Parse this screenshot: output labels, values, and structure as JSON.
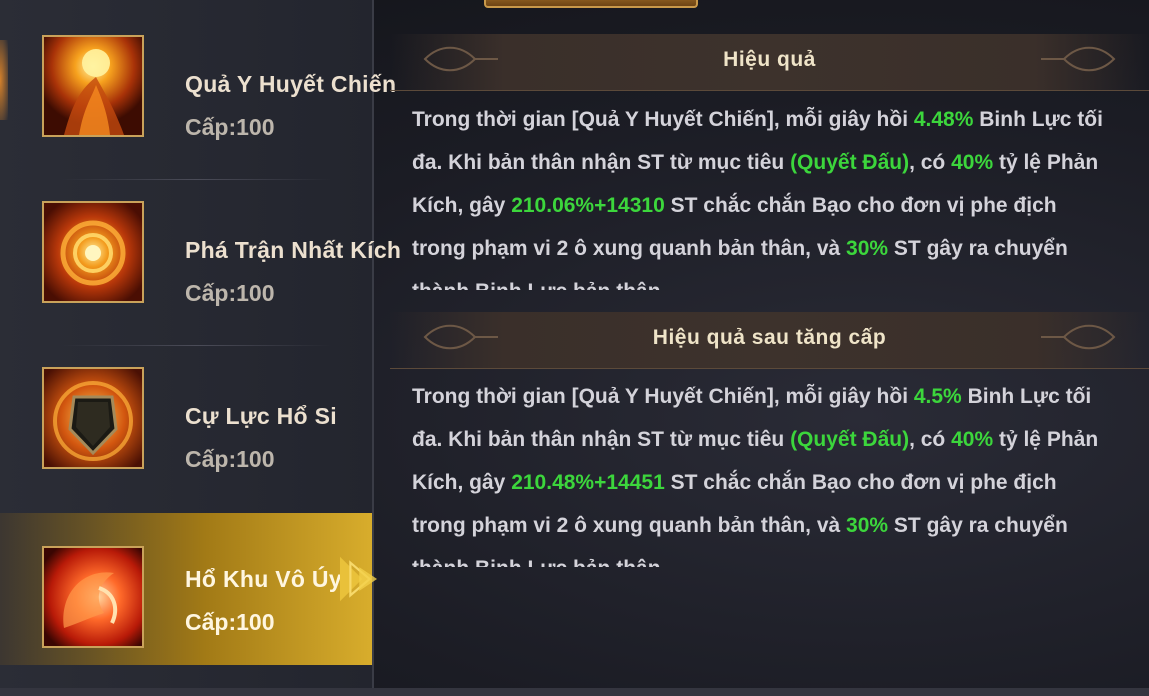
{
  "skills": [
    {
      "name": "Quả Y Huyết Chiến",
      "level": "Cấp:100",
      "icon": "flame-fist-icon",
      "selected": false
    },
    {
      "name": "Phá Trận Nhất Kích",
      "level": "Cấp:100",
      "icon": "fire-vortex-icon",
      "selected": false
    },
    {
      "name": "Cự Lực Hổ Si",
      "level": "Cấp:100",
      "icon": "fire-shield-icon",
      "selected": false
    },
    {
      "name": "Hổ Khu Vô Úy",
      "level": "Cấp:100",
      "icon": "tiger-flame-icon",
      "selected": true
    }
  ],
  "effect": {
    "title": "Hiệu quả",
    "parts": [
      {
        "t": "Trong thời gian [Quả Y Huyết Chiến], mỗi giây hồi "
      },
      {
        "t": "4.48%",
        "hl": true
      },
      {
        "t": " Binh Lực tối đa. Khi bản thân nhận ST từ mục tiêu "
      },
      {
        "t": "(Quyết Đấu)",
        "hl": true
      },
      {
        "t": ", có "
      },
      {
        "t": "40%",
        "hl": true
      },
      {
        "t": " tỷ lệ Phản Kích, gây "
      },
      {
        "t": "210.06%+14310",
        "hl": true
      },
      {
        "t": " ST chắc chắn Bạo cho đơn vị phe địch trong phạm vi 2 ô xung quanh bản thân, và "
      },
      {
        "t": "30%",
        "hl": true
      },
      {
        "t": " ST gây ra chuyển thành Binh Lực bản thân"
      }
    ]
  },
  "upgrade": {
    "title": "Hiệu quả sau tăng cấp",
    "parts": [
      {
        "t": "Trong thời gian [Quả Y Huyết Chiến], mỗi giây hồi "
      },
      {
        "t": "4.5%",
        "hl": true
      },
      {
        "t": " Binh Lực tối đa. Khi bản thân nhận ST từ mục tiêu "
      },
      {
        "t": "(Quyết Đấu)",
        "hl": true
      },
      {
        "t": ", có "
      },
      {
        "t": "40%",
        "hl": true
      },
      {
        "t": " tỷ lệ Phản Kích, gây "
      },
      {
        "t": "210.48%+14451",
        "hl": true
      },
      {
        "t": " ST chắc chắn Bạo cho đơn vị phe địch trong phạm vi 2 ô xung quanh bản thân, và "
      },
      {
        "t": "30%",
        "hl": true
      },
      {
        "t": " ST gây ra chuyển thành Binh Lực bản thân"
      }
    ]
  },
  "colors": {
    "highlight": "#3cd63c",
    "gold": "#d8ad2c",
    "text": "#d4d3da"
  }
}
